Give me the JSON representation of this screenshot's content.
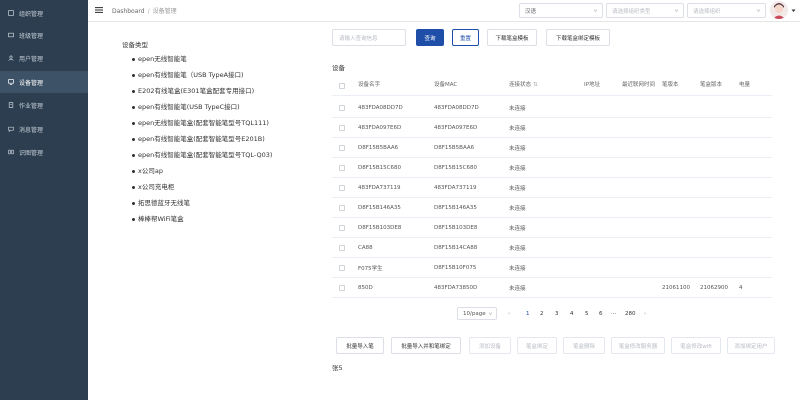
{
  "sidebar": {
    "items": [
      {
        "label": "组织管理",
        "active": false
      },
      {
        "label": "班级管理",
        "active": false
      },
      {
        "label": "用户管理",
        "active": false
      },
      {
        "label": "设备管理",
        "active": true
      },
      {
        "label": "作业管理",
        "active": false
      },
      {
        "label": "消息管理",
        "active": false
      },
      {
        "label": "识图管理",
        "active": false
      }
    ],
    "bg_color": "#2c3e50"
  },
  "header": {
    "breadcrumb": [
      "Dashboard",
      "设备管理"
    ],
    "language_select": "汉语",
    "org_type_placeholder": "请选择组织类型",
    "org_placeholder": "请选择组织"
  },
  "tree": {
    "root": "设备类型",
    "items": [
      "epen无线智能笔",
      "epen有线智能笔（USB TypeA接口)",
      "E202有线笔盒(E301笔盒配套专用接口)",
      "epen有线智能笔(USB TypeC接口)",
      "epen无线智能笔盒(配套智能笔型号TQL111)",
      "epen有线智能笔盒(配套智能笔型号E201B)",
      "epen有线智能笔盒(配套智能笔型号TQL-Q03)",
      "x公司ap",
      "x公司充电柜",
      "拓思德蓝牙无线笔",
      "棒棒帮WiFi笔盒"
    ]
  },
  "toolbar": {
    "search_placeholder": "请输入查询信息",
    "query": "查询",
    "reset": "重置",
    "download_box_template": "下载笔盒模板",
    "download_bind_template": "下载笔盒绑定模板",
    "accent_color": "#1e4ea8"
  },
  "devices": {
    "section_label": "设备",
    "columns": [
      "设备名字",
      "设备MAC",
      "连接状态",
      "IP地址",
      "最近联网时间",
      "笔版本",
      "笔盒版本",
      "电量"
    ],
    "rows": [
      {
        "name": "483FDA08DD7D",
        "mac": "483FDA08DD7D",
        "status": "未连接",
        "ip": "",
        "time": "",
        "pen_ver": "",
        "box_ver": "",
        "battery": ""
      },
      {
        "name": "483FDA097E6D",
        "mac": "483FDA097E6D",
        "status": "未连接",
        "ip": "",
        "time": "",
        "pen_ver": "",
        "box_ver": "",
        "battery": ""
      },
      {
        "name": "D8F15B5BAA6",
        "mac": "D8F15B5BAA6",
        "status": "未连接",
        "ip": "",
        "time": "",
        "pen_ver": "",
        "box_ver": "",
        "battery": ""
      },
      {
        "name": "D8F15B15C680",
        "mac": "D8F15B15C680",
        "status": "未连接",
        "ip": "",
        "time": "",
        "pen_ver": "",
        "box_ver": "",
        "battery": ""
      },
      {
        "name": "483FDA737119",
        "mac": "483FDA737119",
        "status": "未连接",
        "ip": "",
        "time": "",
        "pen_ver": "",
        "box_ver": "",
        "battery": ""
      },
      {
        "name": "D8F15B146A35",
        "mac": "D8F15B146A35",
        "status": "未连接",
        "ip": "",
        "time": "",
        "pen_ver": "",
        "box_ver": "",
        "battery": ""
      },
      {
        "name": "D8F15B103DE8",
        "mac": "D8F15B103DE8",
        "status": "未连接",
        "ip": "",
        "time": "",
        "pen_ver": "",
        "box_ver": "",
        "battery": ""
      },
      {
        "name": "CA88",
        "mac": "D8F15B14CA88",
        "status": "未连接",
        "ip": "",
        "time": "",
        "pen_ver": "",
        "box_ver": "",
        "battery": ""
      },
      {
        "name": "F075学生",
        "mac": "D8F15B10F075",
        "status": "未连接",
        "ip": "",
        "time": "",
        "pen_ver": "",
        "box_ver": "",
        "battery": ""
      },
      {
        "name": "850D",
        "mac": "483FDA73850D",
        "status": "未连接",
        "ip": "",
        "time": "",
        "pen_ver": "21061100",
        "box_ver": "21062900",
        "battery": "4"
      }
    ]
  },
  "pagination": {
    "page_size": "10/page",
    "prev": "‹",
    "pages": [
      "1",
      "2",
      "3",
      "4",
      "5",
      "6",
      "···",
      "280"
    ],
    "next": "›",
    "current": "1"
  },
  "actions": {
    "buttons": [
      {
        "label": "批量导入笔",
        "disabled": false
      },
      {
        "label": "批量导入并和笔绑定",
        "disabled": false
      },
      {
        "label": "添加设备",
        "disabled": true
      },
      {
        "label": "笔盒绑定",
        "disabled": true
      },
      {
        "label": "笔盒删除",
        "disabled": true
      },
      {
        "label": "笔盒修改服务器",
        "disabled": true
      },
      {
        "label": "笔盒修改wifi",
        "disabled": true
      },
      {
        "label": "添加绑定用户",
        "disabled": true
      }
    ]
  },
  "footer": {
    "label": "张5"
  }
}
